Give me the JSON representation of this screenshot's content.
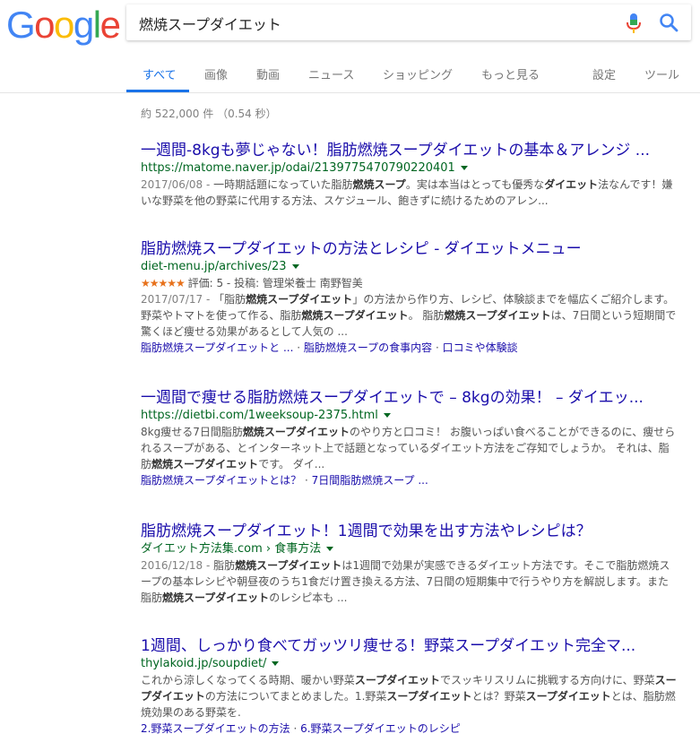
{
  "logo": {
    "text": "Google",
    "letters": [
      "G",
      "o",
      "o",
      "g",
      "l",
      "e"
    ],
    "colors": [
      "#4285F4",
      "#EA4335",
      "#FBBC05",
      "#4285F4",
      "#34A853",
      "#EA4335"
    ]
  },
  "search": {
    "query": "燃焼スープダイエット"
  },
  "tabs": [
    "すべて",
    "画像",
    "動画",
    "ニュース",
    "ショッピング",
    "もっと見る"
  ],
  "tools": [
    "設定",
    "ツール"
  ],
  "stats": "約 522,000 件 （0.54 秒）",
  "results": [
    {
      "title": "一週間-8kgも夢じゃない！脂肪燃焼スープダイエットの基本＆アレンジ ...",
      "url": "https://matome.naver.jp/odai/2139775470790220401",
      "date": "2017/06/08 - ",
      "s1": "一時期話題になっていた脂肪",
      "b1": "燃焼スープ",
      "s2": "。実は本当はとっても優秀な",
      "b2": "ダイエット",
      "s3": "法なんです！嫌いな野菜を他の野菜に代用する方法、スケジュール、飽きずに続けるためのアレン..."
    },
    {
      "title": "脂肪燃焼スープダイエットの方法とレシピ - ダイエットメニュー",
      "url": "diet-menu.jp/archives/23",
      "stars": "★★★★★",
      "rating": " 評価: 5 - 投稿: 管理栄養士 南野智美",
      "date": "2017/07/17 - ",
      "s1": "「脂肪",
      "b1": "燃焼スープダイエット",
      "s2": "」の方法から作り方、レシピ、体験談までを幅広くご紹介します。 野菜やトマトを使って作る、脂肪",
      "b2": "燃焼スープダイエット",
      "s3": "。 脂肪",
      "b3": "燃焼スープダイエット",
      "s4": "は、7日間という短期間で驚くほど痩せる効果があるとして人気の ...",
      "links": [
        "脂肪燃焼スープダイエットと ...",
        "脂肪燃焼スープの食事内容",
        "口コミや体験談"
      ]
    },
    {
      "title": "一週間で痩せる脂肪燃焼スープダイエットで – 8kgの効果！ – ダイエッ...",
      "url": "https://dietbi.com/1weeksoup-2375.html",
      "s1": "8kg痩せる7日間脂肪",
      "b1": "燃焼スープダイエット",
      "s2": "のやり方と口コミ！ お腹いっぱい食べることができるのに、痩せられるスープがある、とインターネット上で話題となっているダイエット方法をご存知でしょうか。 それは、脂肪",
      "b2": "燃焼スープダイエット",
      "s3": "です。 ダイ...",
      "links": [
        "脂肪燃焼スープダイエットとは？",
        "7日間脂肪燃焼スープ ..."
      ]
    },
    {
      "title": "脂肪燃焼スープダイエット！1週間で効果を出す方法やレシピは？",
      "url": "ダイエット方法集.com › 食事方法",
      "date": "2016/12/18 - ",
      "s1": "脂肪",
      "b1": "燃焼スープダイエット",
      "s2": "は1週間で効果が実感できるダイエット方法です。そこで脂肪燃焼スープの基本レシピや朝昼夜のうち1食だけ置き換える方法、7日間の短期集中で行うやり方を解説します。また脂肪",
      "b2": "燃焼スープダイエット",
      "s3": "のレシピ本も ..."
    },
    {
      "title": "1週間、しっかり食べてガッツリ痩せる！野菜スープダイエット完全マ...",
      "url": "thylakoid.jp/soupdiet/",
      "s1": "これから涼しくなってくる時期、暖かい野菜",
      "b1": "スープダイエット",
      "s2": "でスッキリスリムに挑戦する方向けに、野菜",
      "b2": "スープダイエット",
      "s3": "の方法についてまとめました。1.野菜",
      "b3": "スープダイエット",
      "s4": "とは？野菜",
      "b4": "スープダイエット",
      "s5": "とは、脂肪燃焼効果のある野菜を.",
      "links": [
        "2.野菜スープダイエットの方法",
        "6.野菜スープダイエットのレシピ"
      ]
    }
  ],
  "colors": {
    "link": "#1a0dab",
    "url": "#006621",
    "accent": "#1a73e8",
    "star": "#e7711b"
  }
}
